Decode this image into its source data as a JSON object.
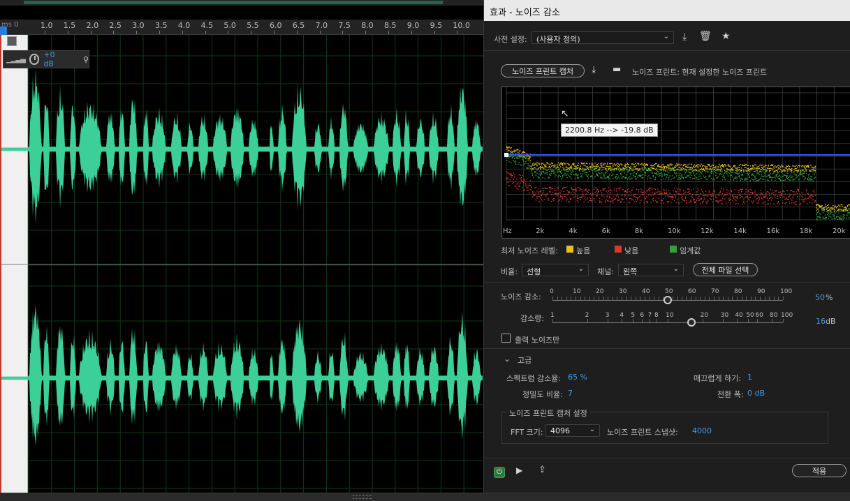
{
  "ruler": {
    "unit": "ms 0",
    "ticks": [
      "1.0",
      "1.5",
      "2.0",
      "2.5",
      "3.0",
      "3.5",
      "4.0",
      "4.5",
      "5.0",
      "5.5",
      "6.0",
      "6.5",
      "7.0",
      "7.5",
      "8.0",
      "8.5",
      "9.0",
      "9.5",
      "10.0"
    ]
  },
  "track": {
    "volume": "+0 dB"
  },
  "panel": {
    "title": "효과 - 노이즈 감소",
    "preset_label": "사전 설정:",
    "preset_value": "(사용자 정의)",
    "capture_button": "노이즈 프린트 캡처",
    "noise_print_status": "노이즈 프린트: 현재 설정한 노이즈 프린트",
    "tooltip": "2200.8 Hz --> -19.8 dB",
    "freq_labels": [
      "Hz",
      "2k",
      "4k",
      "6k",
      "8k",
      "10k",
      "12k",
      "14k",
      "16k",
      "18k",
      "20k"
    ],
    "legend": {
      "label": "최저 노이즈 레벨:",
      "high": "높음",
      "low": "낮음",
      "threshold": "임계값",
      "colors": {
        "high": "#e8c21a",
        "low": "#d9382f",
        "threshold": "#2fa43a"
      }
    },
    "scale_label": "비율:",
    "scale_value": "선형",
    "channel_label": "채널:",
    "channel_value": "왼쪽",
    "select_all_button": "전체 파일 선택",
    "noise_reduction": {
      "label": "노이즈 감소:",
      "ticks": [
        "0",
        "10",
        "20",
        "30",
        "40",
        "50",
        "60",
        "70",
        "80",
        "90",
        "100"
      ],
      "value": "50",
      "unit": "%",
      "fraction": 0.5
    },
    "reduce_by": {
      "label": "감소량:",
      "ticks": [
        "1",
        "2",
        "3",
        "4",
        "5",
        "6",
        "7",
        "8",
        "10",
        "20",
        "30",
        "40",
        "50",
        "60",
        "80",
        "100"
      ],
      "value": "16",
      "unit": "dB"
    },
    "output_noise_only": "출력 노이즈만",
    "advanced": {
      "header": "고급",
      "spectral_decay_label": "스펙트럼 감소율:",
      "spectral_decay_value": "65 %",
      "smoothing_label": "매끄럽게 하기:",
      "smoothing_value": "1",
      "precision_label": "정밀도 비율:",
      "precision_value": "7",
      "transition_label": "전환 폭:",
      "transition_value": "0 dB"
    },
    "capture_settings": {
      "header": "노이즈 프린트 캡처 설정",
      "fft_label": "FFT 크기:",
      "fft_value": "4096",
      "snapshots_label": "노이즈 프린트 스냅샷:",
      "snapshots_value": "4000"
    },
    "apply_button": "적용"
  },
  "icons": [
    "save-preset-icon",
    "delete-preset-icon",
    "favorite-star-icon",
    "save-noise-print-icon",
    "open-folder-icon",
    "power-icon",
    "play-icon",
    "export-icon",
    "pin-icon",
    "volume-knob-icon",
    "chevron-down-icon"
  ]
}
